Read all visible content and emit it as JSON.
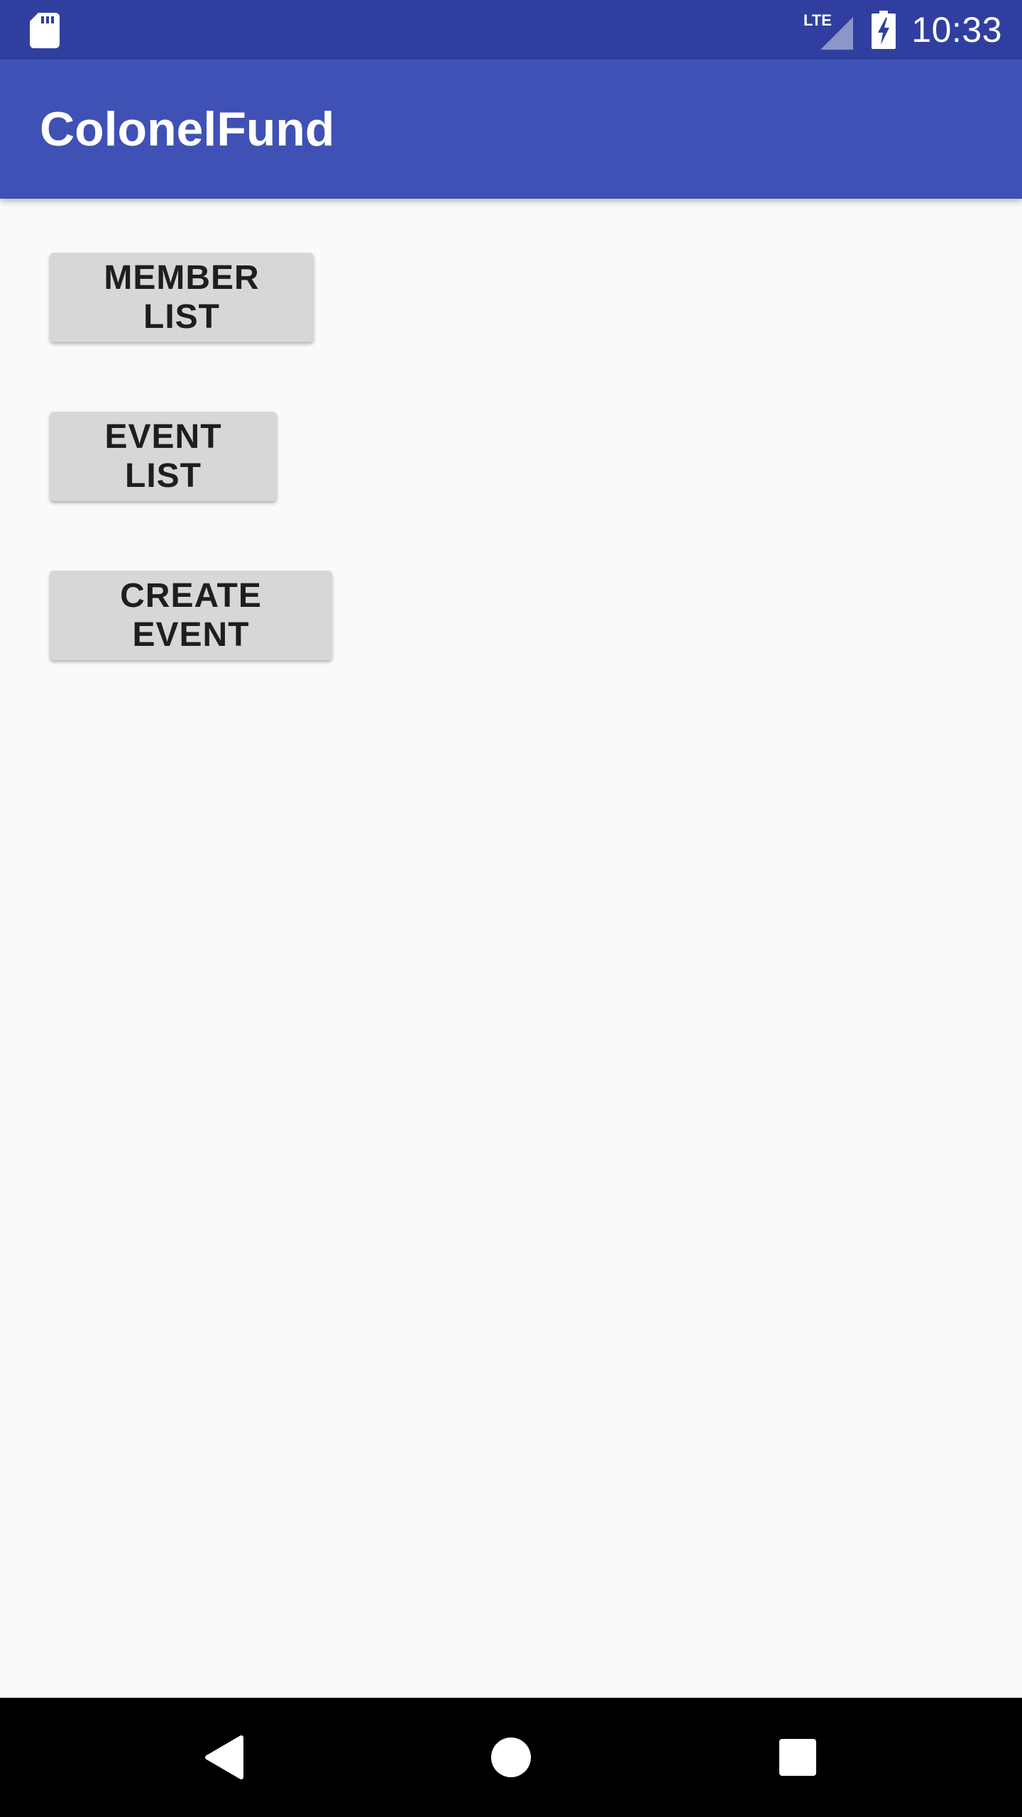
{
  "status_bar": {
    "time": "10:33",
    "network_label": "LTE",
    "icons": [
      "sd-card-icon",
      "lte-signal-icon",
      "battery-charging-icon"
    ],
    "background_color": "#303F9F"
  },
  "app_bar": {
    "title": "ColonelFund",
    "background_color": "#3F51B5"
  },
  "main": {
    "buttons": [
      {
        "label": "MEMBER LIST"
      },
      {
        "label": "EVENT LIST"
      },
      {
        "label": "CREATE EVENT"
      }
    ]
  },
  "nav_bar": {
    "icons": [
      "back-icon",
      "home-icon",
      "recent-apps-icon"
    ]
  }
}
